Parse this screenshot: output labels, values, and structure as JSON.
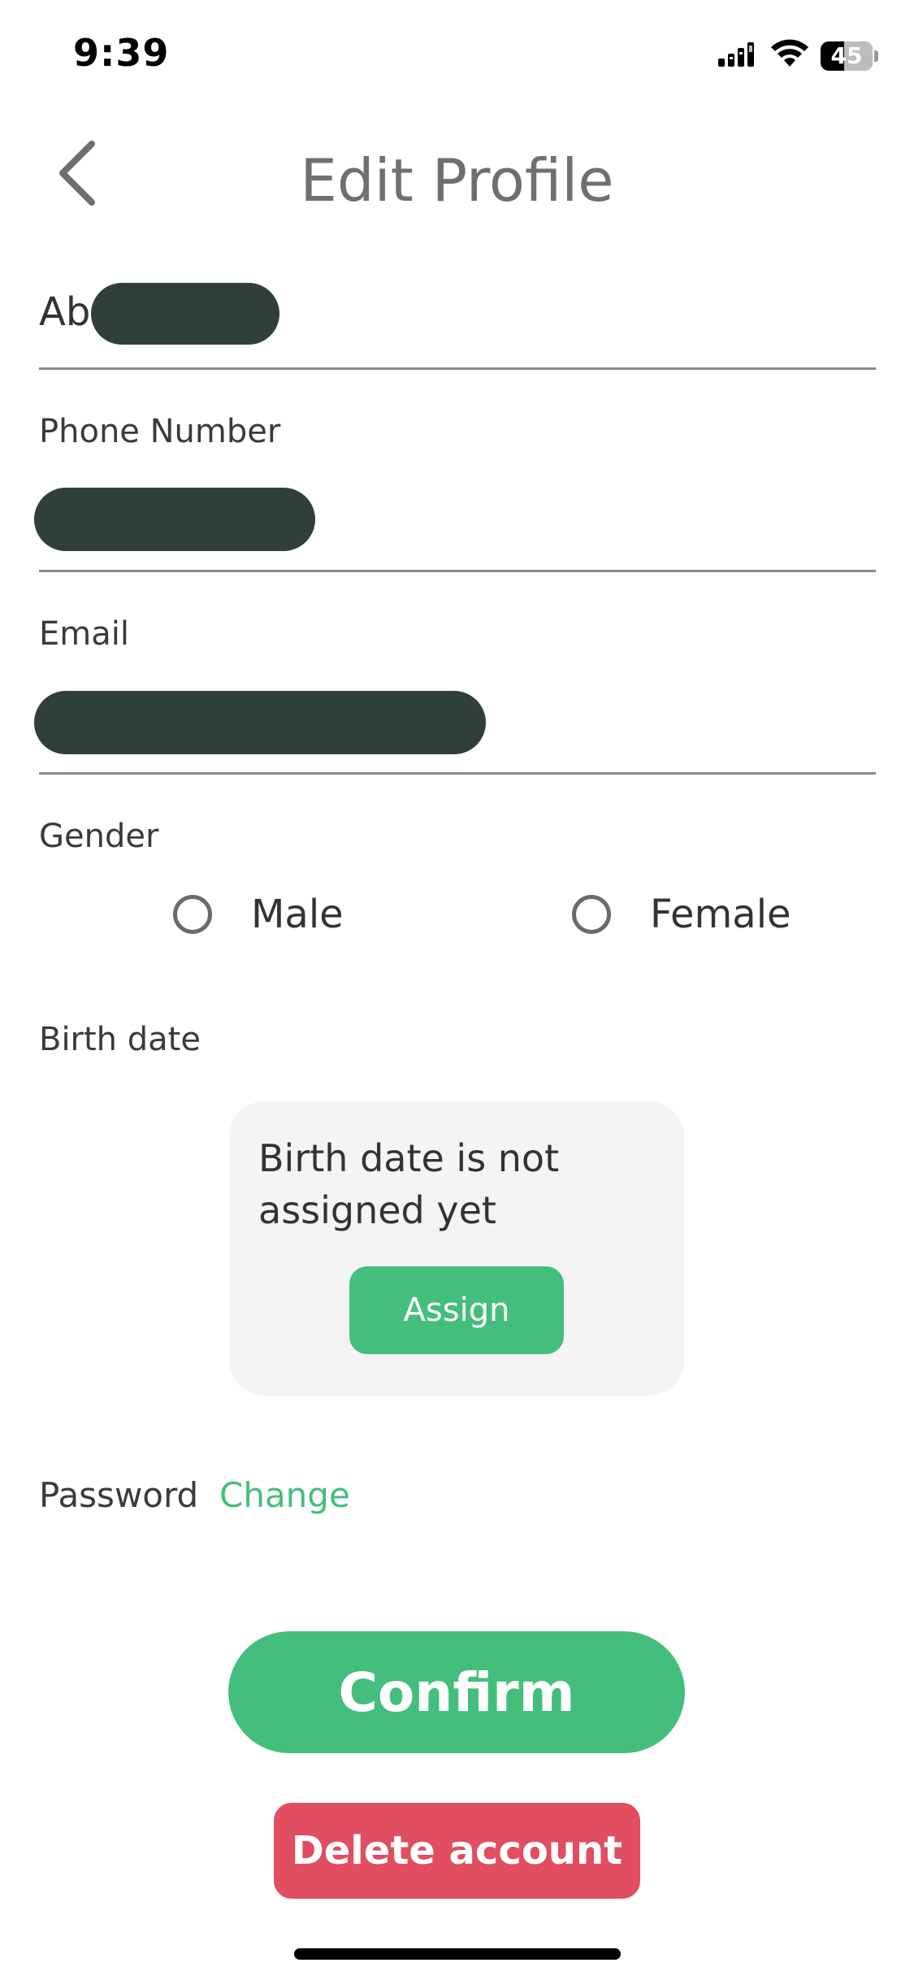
{
  "status_bar": {
    "time": "9:39",
    "battery_level": "45",
    "icons": [
      "signal-icon",
      "wifi-icon",
      "battery-icon"
    ]
  },
  "header": {
    "title": "Edit Profile",
    "back_icon": "chevron-left-icon"
  },
  "fields": {
    "name": {
      "value_visible": "Ab",
      "redacted": true
    },
    "phone": {
      "label": "Phone Number",
      "redacted": true
    },
    "email": {
      "label": "Email",
      "redacted": true
    }
  },
  "gender": {
    "label": "Gender",
    "options": [
      {
        "label": "Male",
        "selected": false
      },
      {
        "label": "Female",
        "selected": false
      }
    ]
  },
  "birth_date": {
    "label": "Birth date",
    "message": "Birth date is not assigned yet",
    "assign_label": "Assign"
  },
  "password": {
    "label": "Password",
    "change_label": "Change"
  },
  "actions": {
    "confirm_label": "Confirm",
    "delete_label": "Delete account"
  },
  "colors": {
    "accent": "#44be7c",
    "danger": "#e04e60",
    "redaction": "#2f403b",
    "card_bg": "#f4f4f4"
  }
}
